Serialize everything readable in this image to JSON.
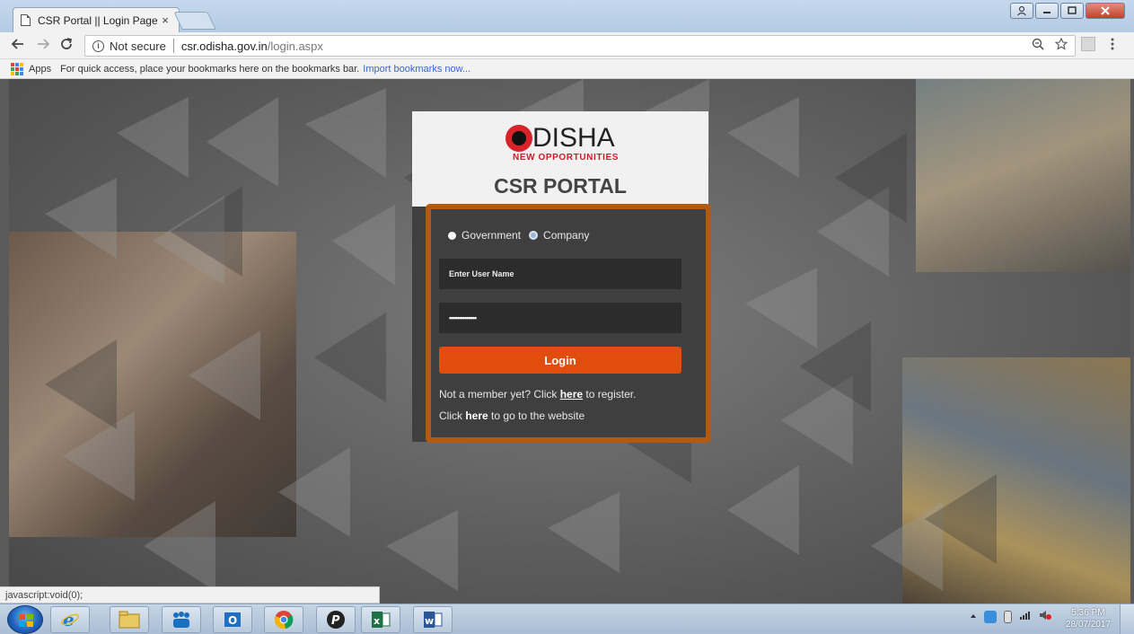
{
  "browser": {
    "tab_title": "CSR Portal || Login Page",
    "tab_close": "×",
    "url_security": "Not secure",
    "url_host": "csr.odisha.gov.in",
    "url_path": "/login.aspx",
    "bookmarks_apps": "Apps",
    "bookmarks_hint": "For quick access, place your bookmarks here on the bookmarks bar.",
    "bookmarks_import": "Import bookmarks now...",
    "status_text": "javascript:void(0);"
  },
  "login": {
    "logo_word": "DISHA",
    "logo_tagline": "NEW OPPORTUNITIES",
    "portal_title": "CSR PORTAL",
    "radio_government": "Government",
    "radio_company": "Company",
    "selected_type": "Company",
    "username_placeholder": "Enter User Name",
    "password_value": "••••••••••••••",
    "login_button": "Login",
    "register_prefix": "Not a member yet? Click",
    "register_link": "here",
    "register_suffix": "to register.",
    "website_prefix": "Click",
    "website_link": "here",
    "website_suffix": "to go to the website"
  },
  "taskbar": {
    "time": "5:36 PM",
    "date": "28/07/2017"
  },
  "colors": {
    "accent_orange": "#e14d0d",
    "highlight_border": "#b35a0e",
    "brand_red": "#d8232a"
  }
}
